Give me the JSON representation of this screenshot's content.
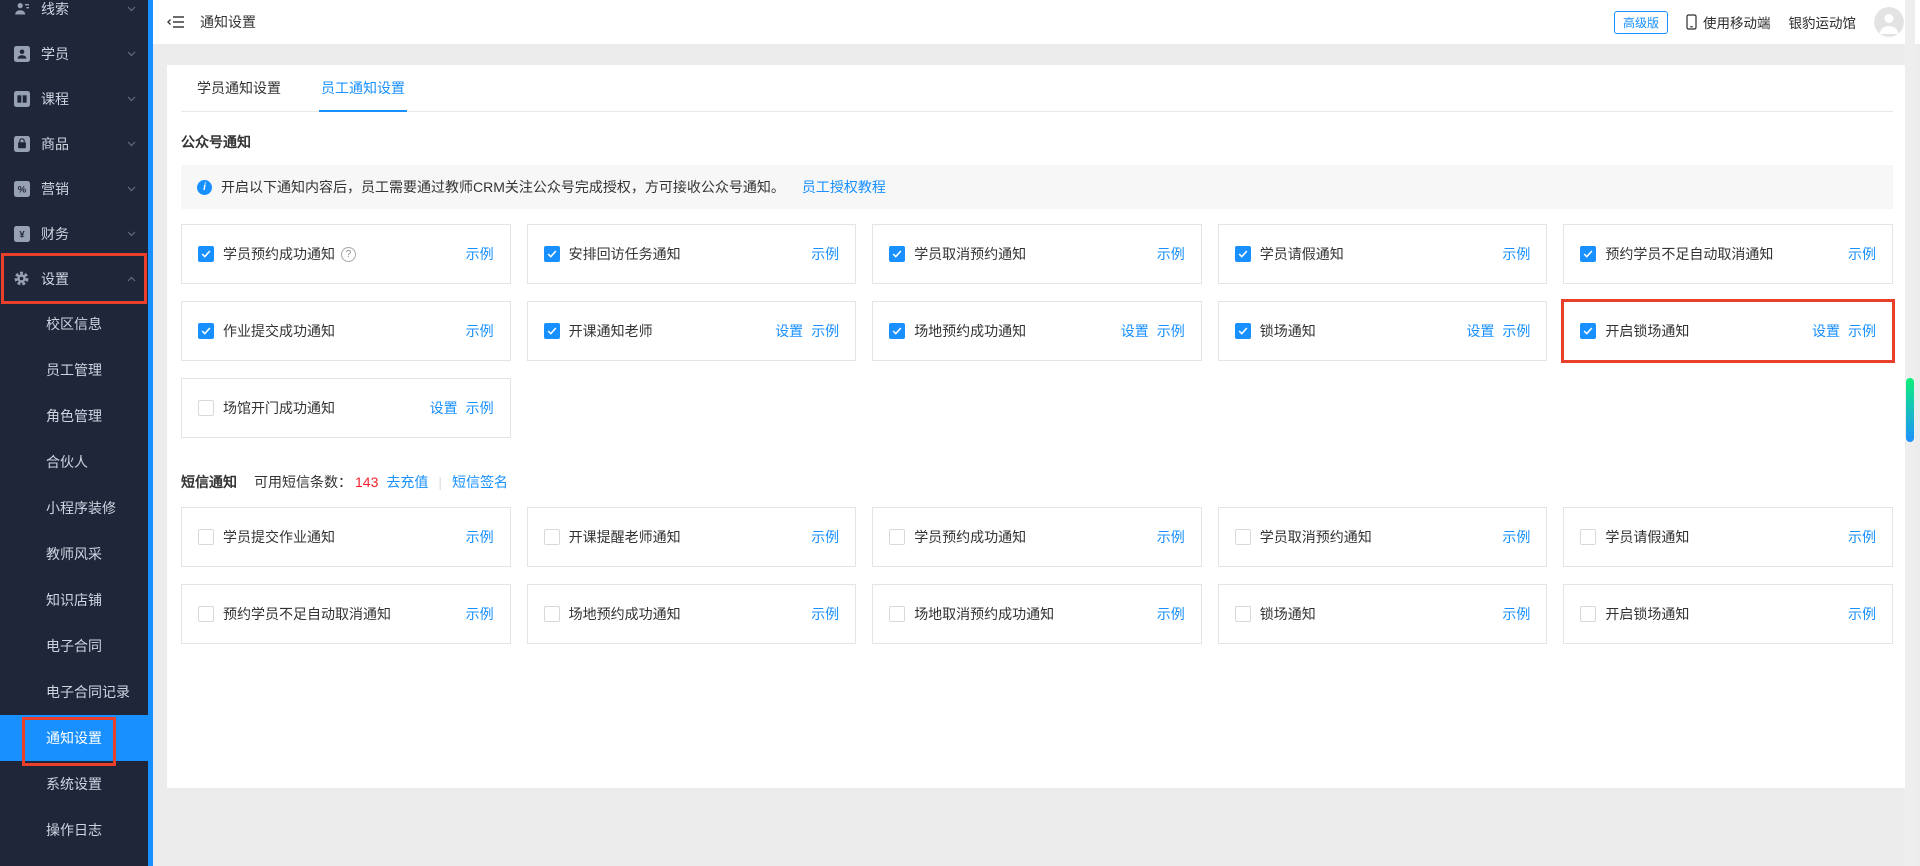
{
  "topbar": {
    "title": "通知设置",
    "badge": "高级版",
    "mobile_label": "使用移动端",
    "account": "银豹运动馆"
  },
  "tabs": [
    {
      "label": "学员通知设置"
    },
    {
      "label": "员工通知设置"
    }
  ],
  "sidebar": {
    "menu": [
      {
        "key": "leads",
        "label": "线索"
      },
      {
        "key": "students",
        "label": "学员"
      },
      {
        "key": "courses",
        "label": "课程"
      },
      {
        "key": "products",
        "label": "商品"
      },
      {
        "key": "marketing",
        "label": "营销"
      },
      {
        "key": "finance",
        "label": "财务"
      },
      {
        "key": "settings",
        "label": "设置",
        "expanded": true,
        "highlighted": true
      }
    ],
    "submenu": [
      {
        "key": "campus-info",
        "label": "校区信息"
      },
      {
        "key": "staff-management",
        "label": "员工管理"
      },
      {
        "key": "role-management",
        "label": "角色管理"
      },
      {
        "key": "partner",
        "label": "合伙人"
      },
      {
        "key": "miniprogram-decoration",
        "label": "小程序装修"
      },
      {
        "key": "teacher-showcase",
        "label": "教师风采"
      },
      {
        "key": "knowledge-store",
        "label": "知识店铺"
      },
      {
        "key": "e-contract",
        "label": "电子合同"
      },
      {
        "key": "e-contract-records",
        "label": "电子合同记录"
      },
      {
        "key": "notification-settings",
        "label": "通知设置",
        "selected": true,
        "highlighted": true
      },
      {
        "key": "system-settings",
        "label": "系统设置"
      },
      {
        "key": "operation-log",
        "label": "操作日志"
      }
    ]
  },
  "wechat": {
    "title": "公众号通知",
    "notice": "开启以下通知内容后，员工需要通过教师CRM关注公众号完成授权，方可接收公众号通知。",
    "notice_link": "员工授权教程",
    "cards": [
      {
        "key": "student-booking-success",
        "label": "学员预约成功通知",
        "checked": true,
        "help": true,
        "links": [
          "示例"
        ]
      },
      {
        "key": "arrange-followup-task",
        "label": "安排回访任务通知",
        "checked": true,
        "links": [
          "示例"
        ]
      },
      {
        "key": "student-cancel-booking",
        "label": "学员取消预约通知",
        "checked": true,
        "links": [
          "示例"
        ]
      },
      {
        "key": "student-leave",
        "label": "学员请假通知",
        "checked": true,
        "links": [
          "示例"
        ]
      },
      {
        "key": "insufficient-auto-cancel",
        "label": "预约学员不足自动取消通知",
        "checked": true,
        "links": [
          "示例"
        ]
      },
      {
        "key": "homework-submit-success",
        "label": "作业提交成功通知",
        "checked": true,
        "links": [
          "示例"
        ]
      },
      {
        "key": "class-start-teacher",
        "label": "开课通知老师",
        "checked": true,
        "links": [
          "设置",
          "示例"
        ]
      },
      {
        "key": "venue-booking-success",
        "label": "场地预约成功通知",
        "checked": true,
        "links": [
          "设置",
          "示例"
        ]
      },
      {
        "key": "lock-venue",
        "label": "锁场通知",
        "checked": true,
        "links": [
          "设置",
          "示例"
        ]
      },
      {
        "key": "open-lock-venue",
        "label": "开启锁场通知",
        "checked": true,
        "links": [
          "设置",
          "示例"
        ],
        "highlighted": true
      },
      {
        "key": "venue-door-open-success",
        "label": "场馆开门成功通知",
        "checked": false,
        "links": [
          "设置",
          "示例"
        ]
      }
    ]
  },
  "sms": {
    "title": "短信通知",
    "quota_label": "可用短信条数：",
    "quota_value": "143",
    "recharge_link": "去充值",
    "sign_link": "短信签名",
    "cards": [
      {
        "key": "student-submit-homework",
        "label": "学员提交作业通知",
        "checked": false,
        "links": [
          "示例"
        ]
      },
      {
        "key": "class-remind-teacher",
        "label": "开课提醒老师通知",
        "checked": false,
        "links": [
          "示例"
        ]
      },
      {
        "key": "student-booking-success",
        "label": "学员预约成功通知",
        "checked": false,
        "links": [
          "示例"
        ]
      },
      {
        "key": "student-cancel-booking",
        "label": "学员取消预约通知",
        "checked": false,
        "links": [
          "示例"
        ]
      },
      {
        "key": "student-leave",
        "label": "学员请假通知",
        "checked": false,
        "links": [
          "示例"
        ]
      },
      {
        "key": "insufficient-auto-cancel",
        "label": "预约学员不足自动取消通知",
        "checked": false,
        "links": [
          "示例"
        ]
      },
      {
        "key": "venue-booking-success",
        "label": "场地预约成功通知",
        "checked": false,
        "links": [
          "示例"
        ]
      },
      {
        "key": "venue-cancel-booking-success",
        "label": "场地取消预约成功通知",
        "checked": false,
        "links": [
          "示例"
        ]
      },
      {
        "key": "lock-venue",
        "label": "锁场通知",
        "checked": false,
        "links": [
          "示例"
        ]
      },
      {
        "key": "open-lock-venue",
        "label": "开启锁场通知",
        "checked": false,
        "links": [
          "示例"
        ]
      }
    ]
  },
  "ui": {
    "settings_label": "设置",
    "example_label": "示例",
    "help_icon": "?",
    "info_icon": "i"
  },
  "colors": {
    "accent": "#1890ff",
    "highlight_red": "#e8402a",
    "quota_red": "#f5222d",
    "sidebar_bg": "#1f2639"
  }
}
